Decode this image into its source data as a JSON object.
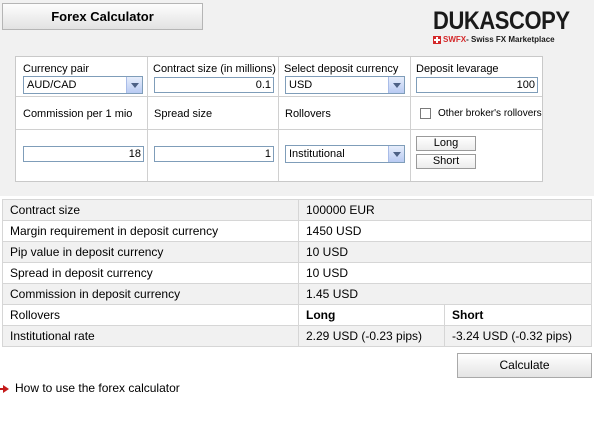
{
  "title": "Forex Calculator",
  "logo": {
    "word": "DUKASCOPY",
    "swfx": "SWFX",
    "tagline": " - Swiss FX Marketplace",
    "accent": "#d4282a"
  },
  "form": {
    "currency_pair": {
      "label": "Currency pair",
      "value": "AUD/CAD"
    },
    "contract_size": {
      "label": "Contract size (in millions)",
      "value": "0.1"
    },
    "deposit_currency": {
      "label": "Select deposit currency",
      "value": "USD"
    },
    "deposit_leverage": {
      "label": "Deposit levarage",
      "value": "100"
    },
    "commission": {
      "label": "Commission per 1 mio",
      "value": "18"
    },
    "spread": {
      "label": "Spread size",
      "value": "1"
    },
    "rollovers": {
      "label": "Rollovers",
      "value": "Institutional"
    },
    "other_brokers": {
      "label": "Other broker's rollovers",
      "checked": false
    },
    "long_label": "Long",
    "short_label": "Short"
  },
  "results": {
    "rows": [
      {
        "label": "Contract size",
        "value": "100000 EUR"
      },
      {
        "label": "Margin requirement in deposit currency",
        "value": "1450 USD"
      },
      {
        "label": "Pip value in deposit currency",
        "value": "10 USD"
      },
      {
        "label": "Spread in deposit currency",
        "value": "10 USD"
      },
      {
        "label": "Commission in deposit currency",
        "value": "1.45 USD"
      }
    ],
    "rollovers_row": {
      "label": "Rollovers",
      "long": "Long",
      "short": "Short"
    },
    "institutional_row": {
      "label": "Institutional rate",
      "long": "2.29 USD (-0.23 pips)",
      "short": "-3.24 USD (-0.32 pips)"
    }
  },
  "calculate_label": "Calculate",
  "help_link": "How to use the forex calculator"
}
